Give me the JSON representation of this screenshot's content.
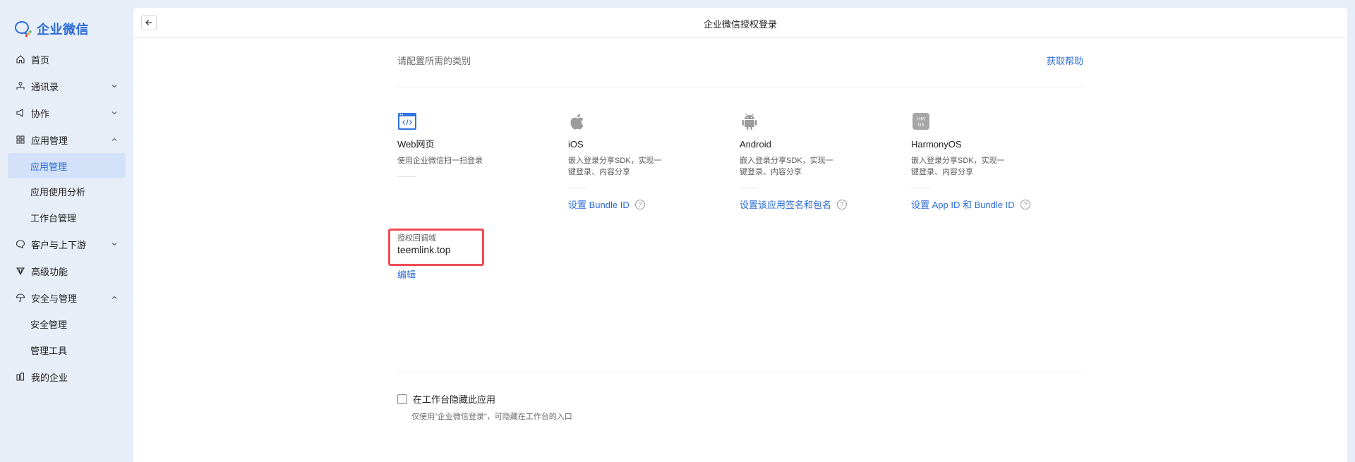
{
  "sidebar": {
    "logo_text": "企业微信",
    "items": [
      {
        "label": "首页",
        "icon": "home-icon"
      },
      {
        "label": "通讯录",
        "icon": "org-chart-icon",
        "chevron": "down"
      },
      {
        "label": "协作",
        "icon": "megaphone-icon",
        "chevron": "down"
      },
      {
        "label": "应用管理",
        "icon": "grid-icon",
        "chevron": "up"
      },
      {
        "label": "应用管理",
        "sub": true,
        "active": true
      },
      {
        "label": "应用使用分析",
        "sub": true
      },
      {
        "label": "工作台管理",
        "sub": true
      },
      {
        "label": "客户与上下游",
        "icon": "chat-bubble-icon",
        "chevron": "down"
      },
      {
        "label": "高级功能",
        "icon": "diamond-icon"
      },
      {
        "label": "安全与管理",
        "icon": "umbrella-icon",
        "chevron": "up"
      },
      {
        "label": "安全管理",
        "sub": true
      },
      {
        "label": "管理工具",
        "sub": true
      },
      {
        "label": "我的企业",
        "icon": "building-icon"
      }
    ]
  },
  "header": {
    "title": "企业微信授权登录"
  },
  "content": {
    "section_label": "请配置所需的类别",
    "help_label": "获取帮助",
    "web": {
      "name": "Web网页",
      "desc": "使用企业微信扫一扫登录",
      "domain_label": "授权回调域",
      "domain_value": "teemlink.top",
      "edit_label": "编辑"
    },
    "ios": {
      "name": "iOS",
      "desc": "嵌入登录分享SDK，实现一键登录、内容分享",
      "link": "设置 Bundle ID"
    },
    "android": {
      "name": "Android",
      "desc": "嵌入登录分享SDK，实现一键登录、内容分享",
      "link": "设置该应用签名和包名"
    },
    "harmony": {
      "name": "HarmonyOS",
      "desc": "嵌入登录分享SDK，实现一键登录、内容分享",
      "link": "设置 App ID 和 Bundle ID",
      "icon_text": "HMOS"
    },
    "qmark": "?",
    "hide_label": "在工作台隐藏此应用",
    "hide_note": "仅使用\"企业微信登录\"，可隐藏在工作台的入口"
  },
  "colors": {
    "accent": "#2b6bd8",
    "highlight_box": "#ef4b55",
    "sidebar_bg": "#e8eef8"
  }
}
